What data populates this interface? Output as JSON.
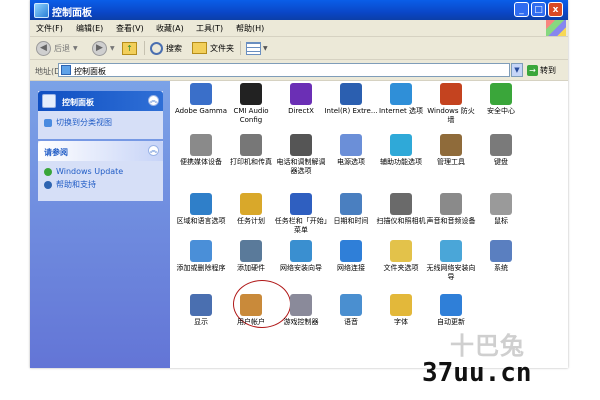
{
  "window": {
    "title": "控制面板",
    "controls": {
      "minimize": "_",
      "maximize": "□",
      "close": "x"
    }
  },
  "menu": [
    "文件(F)",
    "编辑(E)",
    "查看(V)",
    "收藏(A)",
    "工具(T)",
    "帮助(H)"
  ],
  "toolbar": {
    "back": "后退",
    "search": "搜索",
    "folders": "文件夹"
  },
  "address": {
    "label": "地址(D)",
    "value": "控制面板",
    "go": "转到"
  },
  "sidebar": {
    "panel1": {
      "title": "控制面板",
      "links": [
        "切换到分类视图"
      ]
    },
    "panel2": {
      "title": "请参阅",
      "links": [
        "Windows Update",
        "帮助和支持"
      ]
    }
  },
  "items": [
    {
      "label": "Adobe Gamma",
      "icon": "monitor-icon",
      "color": "#3a6fc9"
    },
    {
      "label": "CMI Audio Config",
      "icon": "xear-3d-icon",
      "color": "#222222"
    },
    {
      "label": "DirectX",
      "icon": "directx-icon",
      "color": "#6b2fb5"
    },
    {
      "label": "Intel(R) Extre...",
      "icon": "intel-graphics-icon",
      "color": "#2b5fb0"
    },
    {
      "label": "Internet 选项",
      "icon": "internet-options-icon",
      "color": "#2f8fd8"
    },
    {
      "label": "Windows 防火墙",
      "icon": "firewall-icon",
      "color": "#c4431f"
    },
    {
      "label": "安全中心",
      "icon": "security-center-icon",
      "color": "#3aa63a"
    },
    {
      "label": "便携媒体设备",
      "icon": "portable-media-icon",
      "color": "#8a8a8a"
    },
    {
      "label": "打印机和传真",
      "icon": "printer-icon",
      "color": "#777777"
    },
    {
      "label": "电话和调制解调器选项",
      "icon": "phone-modem-icon",
      "color": "#555555"
    },
    {
      "label": "电源选项",
      "icon": "power-options-icon",
      "color": "#6b8fd8"
    },
    {
      "label": "辅助功能选项",
      "icon": "accessibility-icon",
      "color": "#2fa9d8"
    },
    {
      "label": "管理工具",
      "icon": "admin-tools-icon",
      "color": "#8f6b3a"
    },
    {
      "label": "键盘",
      "icon": "keyboard-icon",
      "color": "#7a7a7a"
    },
    {
      "label": "区域和语言选项",
      "icon": "region-language-icon",
      "color": "#2f7fc9"
    },
    {
      "label": "任务计划",
      "icon": "scheduled-tasks-icon",
      "color": "#d9a82a"
    },
    {
      "label": "任务栏和「开始」菜单",
      "icon": "taskbar-icon",
      "color": "#2f5fc0"
    },
    {
      "label": "日期和时间",
      "icon": "date-time-icon",
      "color": "#4a7fc0"
    },
    {
      "label": "扫描仪和照相机",
      "icon": "scanner-camera-icon",
      "color": "#6a6a6a"
    },
    {
      "label": "声音和音频设备",
      "icon": "sound-icon",
      "color": "#8a8a8a"
    },
    {
      "label": "鼠标",
      "icon": "mouse-icon",
      "color": "#9a9a9a"
    },
    {
      "label": "添加或删除程序",
      "icon": "add-remove-programs-icon",
      "color": "#4a8fd8"
    },
    {
      "label": "添加硬件",
      "icon": "add-hardware-icon",
      "color": "#5a7a9a"
    },
    {
      "label": "网络安装向导",
      "icon": "network-setup-icon",
      "color": "#3a8fd0"
    },
    {
      "label": "网络连接",
      "icon": "network-connections-icon",
      "color": "#2f7fd8"
    },
    {
      "label": "文件夹选项",
      "icon": "folder-options-icon",
      "color": "#e3c24a"
    },
    {
      "label": "无线网络安装向导",
      "icon": "wireless-setup-icon",
      "color": "#4aa6d8"
    },
    {
      "label": "系统",
      "icon": "system-icon",
      "color": "#5a7fc0"
    },
    {
      "label": "显示",
      "icon": "display-icon",
      "color": "#4a6fb0"
    },
    {
      "label": "用户帐户",
      "icon": "user-accounts-icon",
      "color": "#c98a3a"
    },
    {
      "label": "游戏控制器",
      "icon": "game-controller-icon",
      "color": "#8a8a9a"
    },
    {
      "label": "语音",
      "icon": "speech-icon",
      "color": "#4a8fd0"
    },
    {
      "label": "字体",
      "icon": "fonts-icon",
      "color": "#e3b83a"
    },
    {
      "label": "自动更新",
      "icon": "auto-update-icon",
      "color": "#2f7fd8"
    }
  ],
  "watermark": {
    "top": "十巴兔",
    "bottom": "37uu.cn"
  }
}
